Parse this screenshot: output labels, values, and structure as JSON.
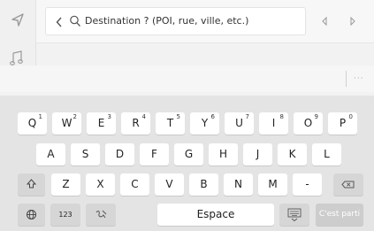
{
  "search": {
    "text": "Destination ? (POI, rue, ville, etc.)"
  },
  "icons": {
    "navigation": "navigation-arrow-icon",
    "music": "music-note-icon",
    "back": "chevron-left-icon",
    "search": "search-icon",
    "prev": "triangle-left-icon",
    "next": "triangle-right-icon",
    "more": "more-dots-icon",
    "shift": "shift-icon",
    "backspace": "backspace-icon",
    "globe": "globe-icon",
    "handwriting": "handwriting-icon",
    "keyboard": "keyboard-hide-icon"
  },
  "candidates": {
    "more_label": "···"
  },
  "keyboard": {
    "row1": [
      {
        "label": "Q",
        "num": "1"
      },
      {
        "label": "W",
        "num": "2"
      },
      {
        "label": "E",
        "num": "3"
      },
      {
        "label": "R",
        "num": "4"
      },
      {
        "label": "T",
        "num": "5"
      },
      {
        "label": "Y",
        "num": "6"
      },
      {
        "label": "U",
        "num": "7"
      },
      {
        "label": "I",
        "num": "8"
      },
      {
        "label": "O",
        "num": "9"
      },
      {
        "label": "P",
        "num": "0"
      }
    ],
    "row2": [
      "A",
      "S",
      "D",
      "F",
      "G",
      "H",
      "J",
      "K",
      "L"
    ],
    "row3": [
      "Z",
      "X",
      "C",
      "V",
      "B",
      "N",
      "M",
      "-"
    ],
    "numbers_label": "123",
    "space_label": "Espace",
    "go_label": "C'est parti"
  },
  "colors": {
    "background": "#f2f2f2",
    "keyboard_bg": "#e4e4e4",
    "key_bg": "#ffffff",
    "func_key_bg": "#d6d6d6"
  }
}
